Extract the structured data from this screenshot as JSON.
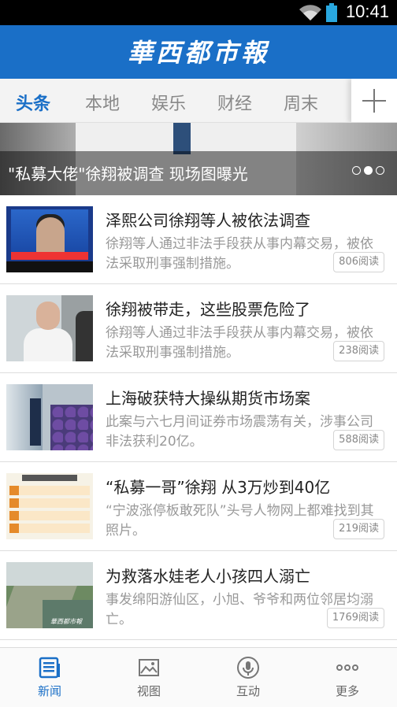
{
  "status_bar": {
    "time": "10:41",
    "wifi_icon": "wifi-icon",
    "battery_icon": "battery-icon"
  },
  "app": {
    "title": "華西都市報",
    "accent_color": "#1a6fc7"
  },
  "tabs": [
    {
      "label": "头条",
      "active": true
    },
    {
      "label": "本地",
      "active": false
    },
    {
      "label": "娱乐",
      "active": false
    },
    {
      "label": "财经",
      "active": false
    },
    {
      "label": "周末",
      "active": false
    }
  ],
  "add_tab_icon": "plus-icon",
  "banner": {
    "caption": "\"私募大佬\"徐翔被调查 现场图曝光",
    "pages": 3,
    "current_page": 2
  },
  "news": [
    {
      "title": "泽熙公司徐翔等人被依法调查",
      "desc": "徐翔等人通过非法手段获从事内幕交易，被依法采取刑事强制措施。",
      "reads": "806阅读"
    },
    {
      "title": "徐翔被带走，这些股票危险了",
      "desc": "徐翔等人通过非法手段获从事内幕交易，被依法采取刑事强制措施。",
      "reads": "238阅读"
    },
    {
      "title": "上海破获特大操纵期货市场案",
      "desc": "此案与六七月间证券市场震荡有关，涉事公司非法获利20亿。",
      "reads": "588阅读"
    },
    {
      "title": "“私募一哥”徐翔 从3万炒到40亿",
      "desc": "“宁波涨停板敢死队”头号人物网上都难找到其照片。",
      "reads": "219阅读"
    },
    {
      "title": "为救落水娃老人小孩四人溺亡",
      "desc": "事发绵阳游仙区，小旭、爷爷和两位邻居均溺亡。",
      "reads": "1769阅读"
    }
  ],
  "thumb5_watermark": "華西都市報",
  "bottom_nav": [
    {
      "label": "新闻",
      "icon": "news-icon",
      "active": true
    },
    {
      "label": "视图",
      "icon": "picture-icon",
      "active": false
    },
    {
      "label": "互动",
      "icon": "microphone-icon",
      "active": false
    },
    {
      "label": "更多",
      "icon": "more-icon",
      "active": false
    }
  ]
}
